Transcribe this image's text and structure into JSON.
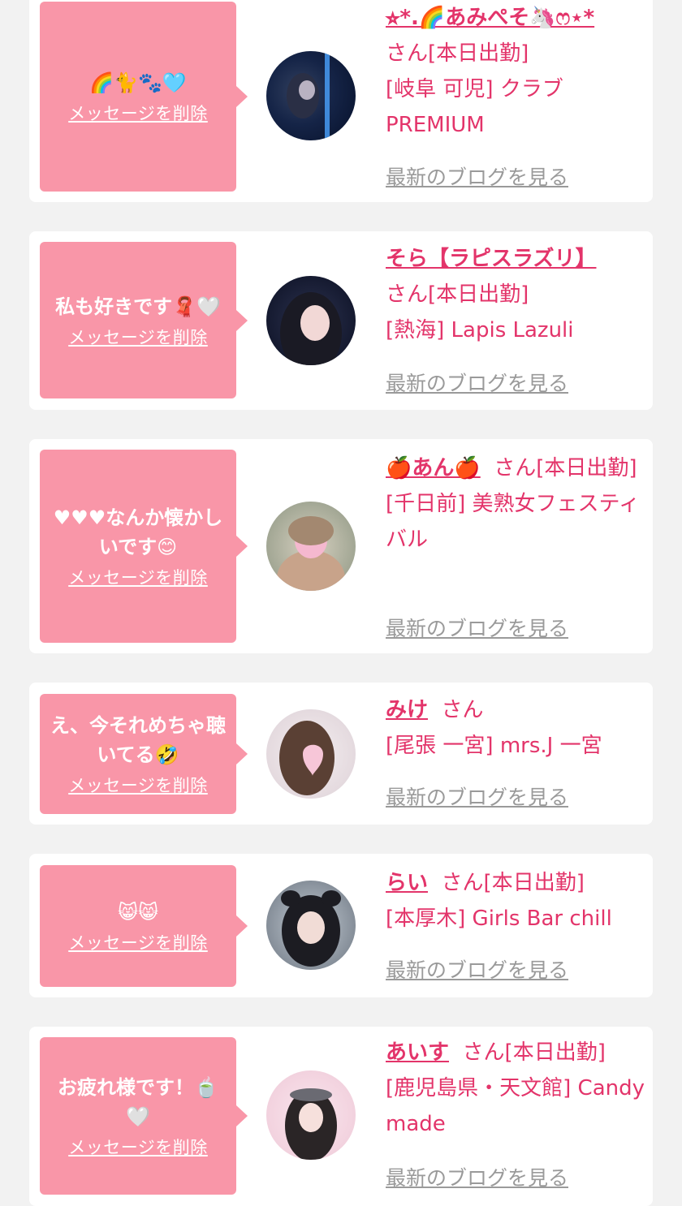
{
  "delete_label": "メッセージを削除",
  "blog_label": "最新のブログを見る",
  "colors": {
    "accent": "#e3346a",
    "bubble": "#f996a8",
    "background": "#f2f2f2"
  },
  "items": [
    {
      "message": "🌈🐈🐾🩵",
      "name": "⭐︎*.🌈あみぺそ🦄ෆ⋆*",
      "suffix": "さん[本日出勤]",
      "shop": "[岐阜 可児] クラブPREMIUM"
    },
    {
      "message": "私も好きです🧣🤍",
      "name": "そら【ラピスラズリ】",
      "suffix": "さん[本日出勤]",
      "shop": "[熱海] Lapis Lazuli"
    },
    {
      "message": "♥♥♥なんか懐かしいです😊",
      "name": "🍎あん🍎",
      "suffix": "さん[本日出勤]",
      "shop": "[千日前] 美熟女フェスティバル"
    },
    {
      "message": "え、今それめちゃ聴いてる🤣",
      "name": "みけ",
      "suffix": "さん",
      "shop": "[尾張 一宮] mrs.J 一宮"
    },
    {
      "message": "😸😸",
      "name": "らい",
      "suffix": "さん[本日出勤]",
      "shop": "[本厚木] Girls Bar chill"
    },
    {
      "message": "お疲れ様です！🍵🤍",
      "name": "あいす",
      "suffix": "さん[本日出勤]",
      "shop": "[鹿児島県・天文館] Candy made"
    }
  ]
}
